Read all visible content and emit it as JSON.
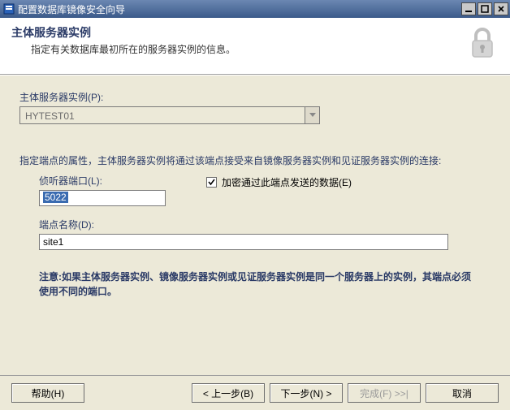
{
  "window": {
    "title": "配置数据库镜像安全向导"
  },
  "header": {
    "heading": "主体服务器实例",
    "subtext": "指定有关数据库最初所在的服务器实例的信息。"
  },
  "body": {
    "instance_label": "主体服务器实例(P):",
    "instance_value": "HYTEST01",
    "desc": "指定端点的属性，主体服务器实例将通过该端点接受来自镜像服务器实例和见证服务器实例的连接:",
    "listener_label": "侦听器端口(L):",
    "listener_value": "5022",
    "encrypt_label": "加密通过此端点发送的数据(E)",
    "encrypt_checked": true,
    "endpoint_label": "端点名称(D):",
    "endpoint_value": "site1",
    "note": "注意:如果主体服务器实例、镜像服务器实例或见证服务器实例是同一个服务器上的实例，其端点必须使用不同的端口。"
  },
  "footer": {
    "help": "帮助(H)",
    "back": "< 上一步(B)",
    "next": "下一步(N) >",
    "finish": "完成(F) >>|",
    "cancel": "取消"
  }
}
